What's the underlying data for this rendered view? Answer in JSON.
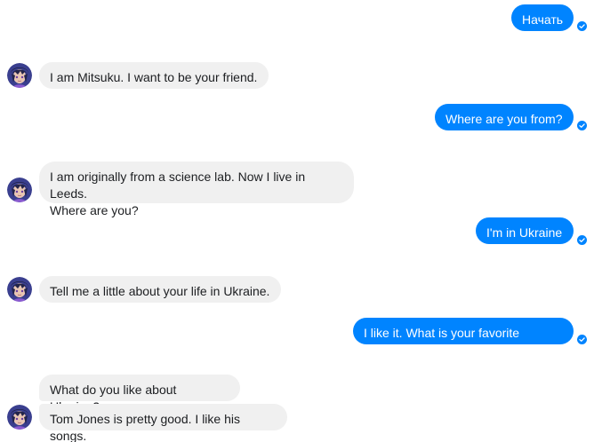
{
  "conversation": {
    "messages": [
      {
        "from": "user",
        "text": "Начать"
      },
      {
        "from": "bot",
        "text": "I am Mitsuku. I want to be your friend."
      },
      {
        "from": "user",
        "text": "Where are you from?"
      },
      {
        "from": "bot",
        "text": "I am originally from a science lab. Now I live in Leeds.\nWhere are you?"
      },
      {
        "from": "user",
        "text": "I'm in Ukraine"
      },
      {
        "from": "bot",
        "text": "Tell me a little about your life in Ukraine."
      },
      {
        "from": "user",
        "text": "I like it. What is your favorite singer?"
      },
      {
        "from": "bot",
        "text": "What do you like about Ukraine?"
      },
      {
        "from": "bot",
        "text": "Tom Jones is pretty good. I like his songs."
      }
    ]
  },
  "colors": {
    "outgoing_bubble": "#0084ff",
    "incoming_bubble": "#f0f0f0",
    "delivered_tick": "#0084ff"
  },
  "icons": {
    "bot_avatar": "avatar",
    "delivered": "check-circle-icon"
  }
}
